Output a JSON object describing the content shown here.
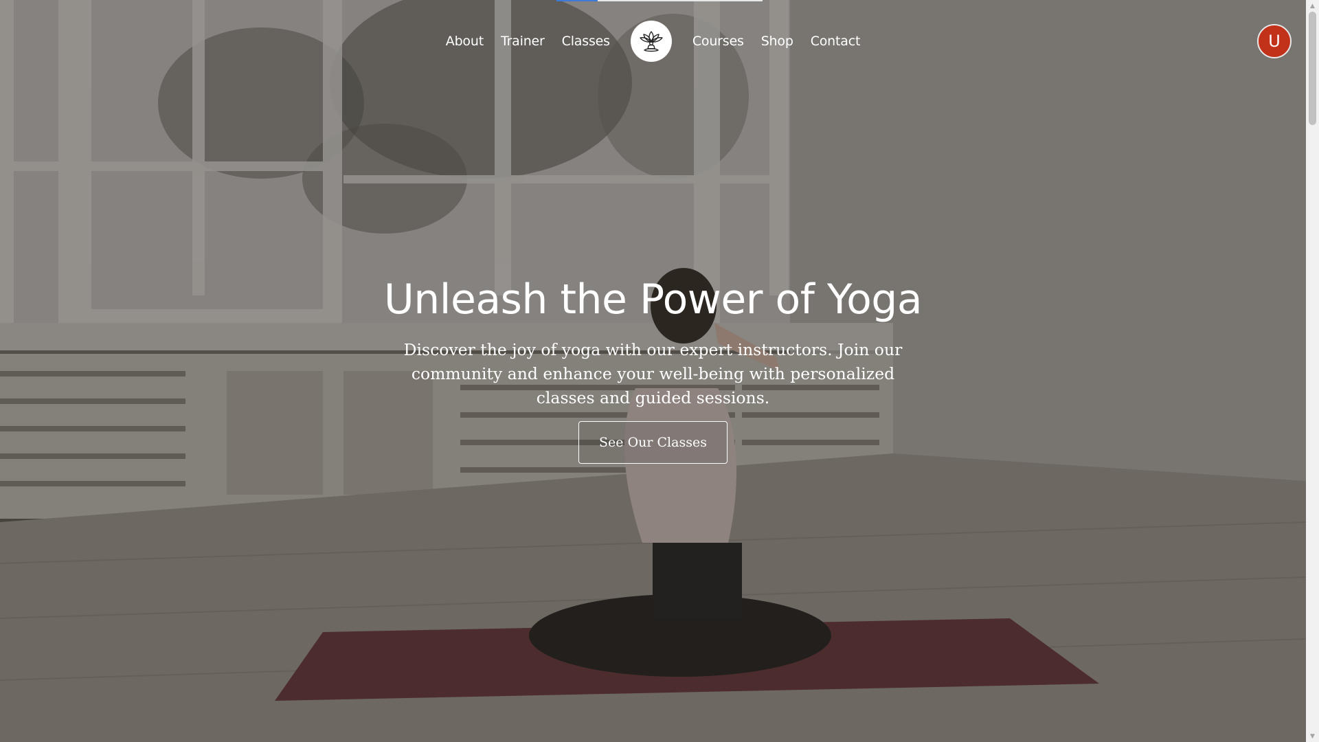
{
  "nav": {
    "left_items": [
      {
        "label": "About"
      },
      {
        "label": "Trainer"
      },
      {
        "label": "Classes"
      }
    ],
    "right_items": [
      {
        "label": "Courses"
      },
      {
        "label": "Shop"
      },
      {
        "label": "Contact"
      }
    ],
    "logo_icon": "lotus-meditation-icon"
  },
  "user": {
    "avatar_initial": "U",
    "avatar_color": "#c2311a"
  },
  "hero": {
    "title": "Unleash the Power of Yoga",
    "subtitle": "Discover the joy of yoga with our expert instructors. Join our community and enhance your well-being with personalized classes and guided sessions.",
    "cta_label": "See Our Classes",
    "background_description_icon": "yoga-studio-photo"
  },
  "page_progress": 0.2,
  "colors": {
    "progress_accent": "#3d7ad6",
    "text": "#ffffff"
  }
}
